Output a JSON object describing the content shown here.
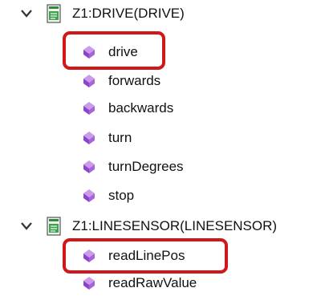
{
  "tree": {
    "nodes": [
      {
        "label": "Z1:DRIVE(DRIVE)",
        "methods": [
          "drive",
          "forwards",
          "backwards",
          "turn",
          "turnDegrees",
          "stop"
        ]
      },
      {
        "label": "Z1:LINESENSOR(LINESENSOR)",
        "methods": [
          "readLinePos",
          "readRawValue"
        ]
      }
    ],
    "highlighted": [
      "drive",
      "readLinePos"
    ],
    "colors": {
      "method_icon": "#9b59d0",
      "highlight_border": "#d01818",
      "class_icon_green": "#2e8b3a"
    }
  }
}
